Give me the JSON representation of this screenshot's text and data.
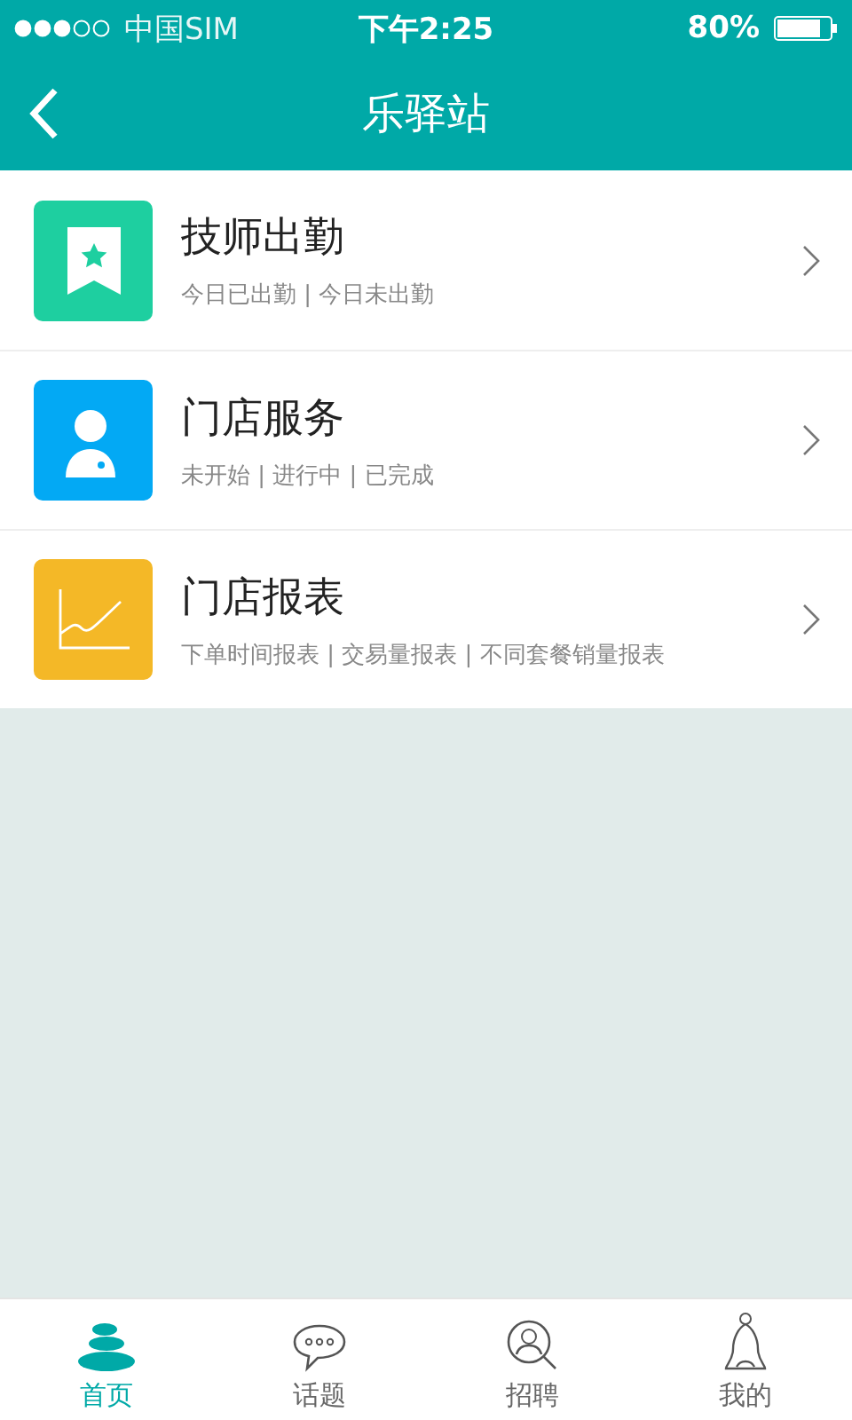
{
  "status_bar": {
    "carrier": "中国SIM",
    "time": "下午2:25",
    "battery": "80%"
  },
  "nav_bar": {
    "title": "乐驿站"
  },
  "menu": [
    {
      "kind": "attendance",
      "color": "#1ecfa0",
      "title": "技师出勤",
      "subtitle": "今日已出勤 | 今日未出勤"
    },
    {
      "kind": "service",
      "color": "#03a9f4",
      "title": "门店服务",
      "subtitle": "未开始 | 进行中 | 已完成"
    },
    {
      "kind": "report",
      "color": "#f4b827",
      "title": "门店报表",
      "subtitle": "下单时间报表 | 交易量报表 | 不同套餐销量报表"
    }
  ],
  "tab_bar": [
    {
      "kind": "home",
      "label": "首页",
      "selected": true
    },
    {
      "kind": "topic",
      "label": "话题",
      "selected": false
    },
    {
      "kind": "recruit",
      "label": "招聘",
      "selected": false
    },
    {
      "kind": "profile",
      "label": "我的",
      "selected": false
    }
  ]
}
